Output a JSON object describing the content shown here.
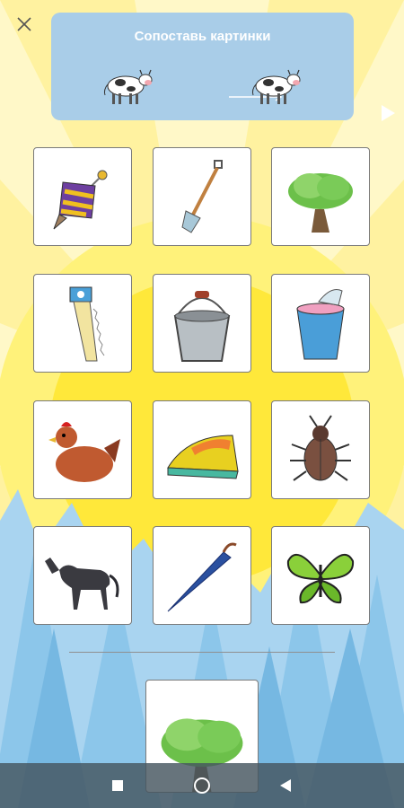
{
  "header": {
    "title": "Сопоставь картинки",
    "close_icon": "close-icon",
    "play_icon": "play-icon"
  },
  "cards": [
    {
      "name": "spinning-top"
    },
    {
      "name": "shovel"
    },
    {
      "name": "tree"
    },
    {
      "name": "saw"
    },
    {
      "name": "bucket"
    },
    {
      "name": "yogurt-cup"
    },
    {
      "name": "hen"
    },
    {
      "name": "iron"
    },
    {
      "name": "beetle"
    },
    {
      "name": "horse"
    },
    {
      "name": "umbrella"
    },
    {
      "name": "butterfly"
    }
  ],
  "target_card": {
    "name": "tree"
  },
  "navbar": {
    "items": [
      "recents-button",
      "home-button",
      "back-button"
    ]
  },
  "colors": {
    "banner": "#a9cde8",
    "sun": "#ffe83a",
    "trees_light": "#a9d4f0",
    "trees_dark": "#7fbde6",
    "navbar": "#46555f"
  }
}
